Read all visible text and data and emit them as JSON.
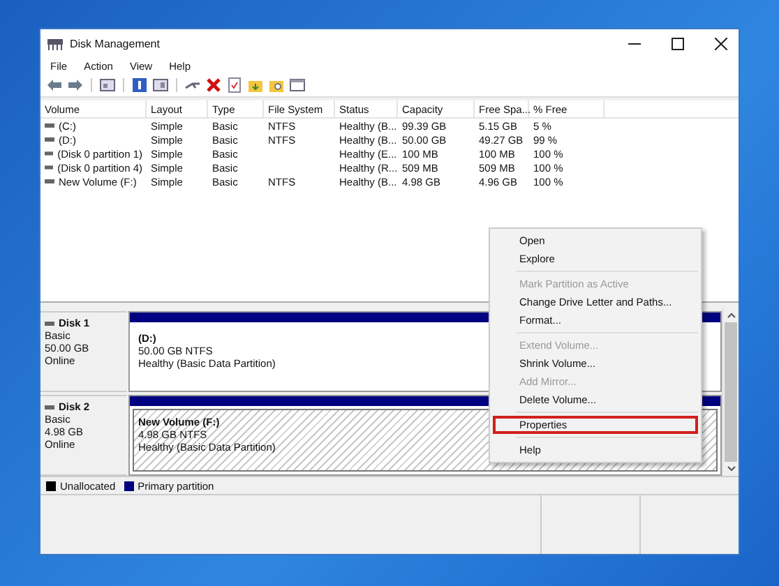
{
  "window": {
    "title": "Disk Management"
  },
  "menu": [
    "File",
    "Action",
    "View",
    "Help"
  ],
  "table": {
    "columns": [
      "Volume",
      "Layout",
      "Type",
      "File System",
      "Status",
      "Capacity",
      "Free Spa...",
      "% Free"
    ],
    "rows": [
      {
        "cells": [
          "(C:)",
          "Simple",
          "Basic",
          "NTFS",
          "Healthy (B...",
          "99.39 GB",
          "5.15 GB",
          "5 %"
        ]
      },
      {
        "cells": [
          "(D:)",
          "Simple",
          "Basic",
          "NTFS",
          "Healthy (B...",
          "50.00 GB",
          "49.27 GB",
          "99 %"
        ]
      },
      {
        "cells": [
          "(Disk 0 partition 1)",
          "Simple",
          "Basic",
          "",
          "Healthy (E...",
          "100 MB",
          "100 MB",
          "100 %"
        ]
      },
      {
        "cells": [
          "(Disk 0 partition 4)",
          "Simple",
          "Basic",
          "",
          "Healthy (R...",
          "509 MB",
          "509 MB",
          "100 %"
        ]
      },
      {
        "cells": [
          "New Volume (F:)",
          "Simple",
          "Basic",
          "NTFS",
          "Healthy (B...",
          "4.98 GB",
          "4.96 GB",
          "100 %"
        ]
      }
    ]
  },
  "disks": [
    {
      "name": "Disk 1",
      "type": "Basic",
      "size": "50.00 GB",
      "state": "Online",
      "partitions": [
        {
          "name": "(D:)",
          "detail": "50.00 GB NTFS",
          "status": "Healthy (Basic Data Partition)",
          "selected": false
        }
      ]
    },
    {
      "name": "Disk 2",
      "type": "Basic",
      "size": "4.98 GB",
      "state": "Online",
      "partitions": [
        {
          "name": "New Volume  (F:)",
          "detail": "4.98 GB NTFS",
          "status": "Healthy (Basic Data Partition)",
          "selected": true
        }
      ]
    }
  ],
  "legend": [
    {
      "label": "Unallocated",
      "color": "#000000"
    },
    {
      "label": "Primary partition",
      "color": "#000080"
    }
  ],
  "context_menu": [
    {
      "kind": "item",
      "label": "Open",
      "disabled": false,
      "highlighted": false
    },
    {
      "kind": "item",
      "label": "Explore",
      "disabled": false,
      "highlighted": false
    },
    {
      "kind": "separator"
    },
    {
      "kind": "item",
      "label": "Mark Partition as Active",
      "disabled": true,
      "highlighted": false
    },
    {
      "kind": "item",
      "label": "Change Drive Letter and Paths...",
      "disabled": false,
      "highlighted": false
    },
    {
      "kind": "item",
      "label": "Format...",
      "disabled": false,
      "highlighted": false
    },
    {
      "kind": "separator"
    },
    {
      "kind": "item",
      "label": "Extend Volume...",
      "disabled": true,
      "highlighted": false
    },
    {
      "kind": "item",
      "label": "Shrink Volume...",
      "disabled": false,
      "highlighted": false
    },
    {
      "kind": "item",
      "label": "Add Mirror...",
      "disabled": true,
      "highlighted": false
    },
    {
      "kind": "item",
      "label": "Delete Volume...",
      "disabled": false,
      "highlighted": false
    },
    {
      "kind": "separator"
    },
    {
      "kind": "item",
      "label": "Properties",
      "disabled": false,
      "highlighted": true
    },
    {
      "kind": "separator"
    },
    {
      "kind": "item",
      "label": "Help",
      "disabled": false,
      "highlighted": false
    }
  ]
}
